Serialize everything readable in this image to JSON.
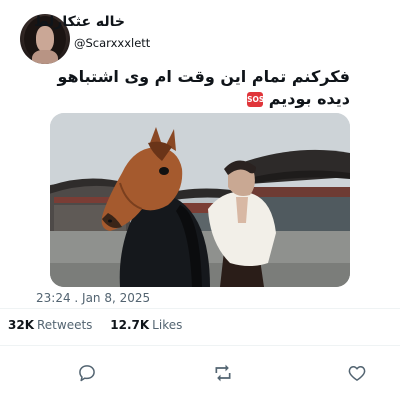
{
  "user": {
    "display_name": "خاله عثکارلط",
    "handle": "@Scarxxxlett"
  },
  "tweet": {
    "text_line1": "فکرکنم تمام این وقت ام وی اشتباهو",
    "text_line2": "دیده بودیم",
    "emoji_label": "SOS",
    "media_alt": "man in white fur coat riding a horse beside a person in a horse mask, traditional Korean palace in background",
    "timestamp": "23:24  .  Jan 8, 2025"
  },
  "stats": {
    "retweets_count": "32K",
    "retweets_label": "Retweets",
    "likes_count": "12.7K",
    "likes_label": "Likes"
  },
  "actions": {
    "reply_icon": "comment-icon",
    "retweet_icon": "retweet-icon",
    "like_icon": "heart-icon"
  },
  "colors": {
    "text": "#0f1419",
    "secondary": "#536471",
    "divider": "#eff3f4",
    "sos": "#e0353a"
  }
}
